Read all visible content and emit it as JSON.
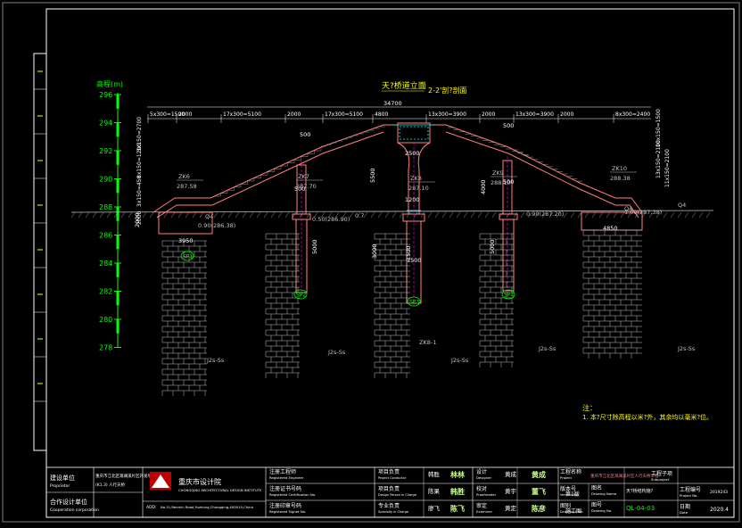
{
  "drawing": {
    "title_main": "天?桥道立面",
    "title_sub": "2-2'剖?剖面",
    "elevation_axis_label": "高程(m)",
    "elevation_ticks": [
      "296",
      "294",
      "292",
      "290",
      "288",
      "286",
      "284",
      "282",
      "280",
      "278"
    ],
    "top_dimensions": [
      "5x300=1500",
      "2000",
      "17x300=5100",
      "2000",
      "17x300=5100",
      "4800",
      "13x300=3900",
      "2000",
      "13x300=3900",
      "2000",
      "8x300=2400"
    ],
    "overall_span": "34700",
    "mid_dims": [
      "500",
      "2500",
      "1200",
      "500",
      "500",
      "500"
    ],
    "vertical_dims": [
      "5500",
      "4000",
      "5000",
      "3000",
      "5000",
      "2000",
      "1500"
    ],
    "boreholes": [
      {
        "id": "ZK6",
        "elev": "287.58"
      },
      {
        "id": "ZK7",
        "elev": "287.70"
      },
      {
        "id": "ZK8",
        "elev": "287.10"
      },
      {
        "id": "ZK9",
        "elev": "288.10"
      },
      {
        "id": "ZK10",
        "elev": "288.38"
      }
    ],
    "ground_marks": [
      "Q4",
      "0.90(286.38)",
      "0.50(286.90)",
      "0.7",
      "0.90(287.20)",
      "Q4",
      "1.00(287.38)",
      "Q4"
    ],
    "left_dims": [
      "8x150=1200",
      "3x150=2700",
      "3x150=450",
      "2000"
    ],
    "right_dims": [
      "10x150=1500",
      "13x150=2100",
      "11x150=2100"
    ],
    "foundation_widths": [
      "3950",
      "4850",
      "1500"
    ],
    "piers": [
      "SP1",
      "SP2",
      "SP3",
      "SP4"
    ],
    "strata": [
      "J2s-Ss",
      "J2s-Ss",
      "J2s-Ss",
      "J2s-Ss",
      "J2s-Ss",
      "J2s-Ss"
    ],
    "zk_bottom": "ZK8-1",
    "note_title": "注：",
    "note_text": "1. 本?尺寸除高程以米?外，其余均以毫米?位。"
  },
  "title_block": {
    "left_labels": [
      "建设单位",
      "Proprietor",
      "合作设计单位",
      "Cooperation corporation"
    ],
    "project_name_1": "重庆市江北区溉澜溪片区开发项目",
    "project_name_2": "(K1.3) 人行天桥",
    "company_name": "重庆市设计院",
    "company_en": "CHONGQING ARCHITECTURAL DESIGN INSTITUTE",
    "company_addr_label": "ADD:",
    "company_addr": "No.31,Renmin Road,Yuzhong,Chongqing,400015,China",
    "reg_labels": [
      {
        "cn": "注册工程师",
        "en": "Registered Engineer"
      },
      {
        "cn": "注册证书号码",
        "en": "Registered Certification No."
      },
      {
        "cn": "注册印章号码",
        "en": "Registered Signet No."
      }
    ],
    "role_labels": [
      {
        "cn": "项目负责",
        "en": "Project Conductor"
      },
      {
        "cn": "项目负责",
        "en": "Design Person in Charge"
      },
      {
        "cn": "专业负责",
        "en": "Specialty in Charge"
      }
    ],
    "names": [
      "韩胜",
      "陈果",
      "廖飞"
    ],
    "sign_marks": [
      "林林",
      "韩胜",
      "陈飞"
    ],
    "check_labels": [
      {
        "cn": "设计",
        "en": "Designer"
      },
      {
        "cn": "校对",
        "en": "Proofreader"
      },
      {
        "cn": "审定",
        "en": "Examiner"
      }
    ],
    "checkers": [
      "黄成",
      "黄宇",
      "黄定"
    ],
    "sign_marks_2": [
      "黄成",
      "董飞",
      "陈彦"
    ],
    "project_labels": [
      {
        "cn": "工程名称",
        "en": "Project"
      },
      {
        "cn": "版本号",
        "en": "Version No."
      },
      {
        "cn": "图别",
        "en": "Drawing Item"
      }
    ],
    "project_title": "重庆市江北区溉澜溪片区人行天桥工程",
    "version": "第1版",
    "drawing_type": "施工图",
    "drawing_name_label": "图名",
    "drawing_name_label_en": "Drawing Name",
    "drawing_name": "天?桥结构施?",
    "drawing_no_label": "图号",
    "drawing_no_label_en": "Drawing No.",
    "drawing_no": "QL-04-03",
    "subproject_label": "工程子项",
    "subproject_en": "Subproject",
    "project_no_label": "工程编号",
    "project_no_en": "Project No.",
    "project_no": "2019243",
    "date_label": "日期",
    "date_en": "Date",
    "date": "2020.4"
  },
  "colors": {
    "background": "#000000",
    "frame": "#ffffff",
    "structure": "#ff7f7f",
    "dimension": "#ffffff",
    "elevation": "#00ff00",
    "label": "#ffff00",
    "pier_tag": "#00ff00",
    "hatch": "#c0c0c0",
    "title": "#ffff00",
    "accent_cyan": "#00ffff",
    "note": "#ffff00"
  }
}
